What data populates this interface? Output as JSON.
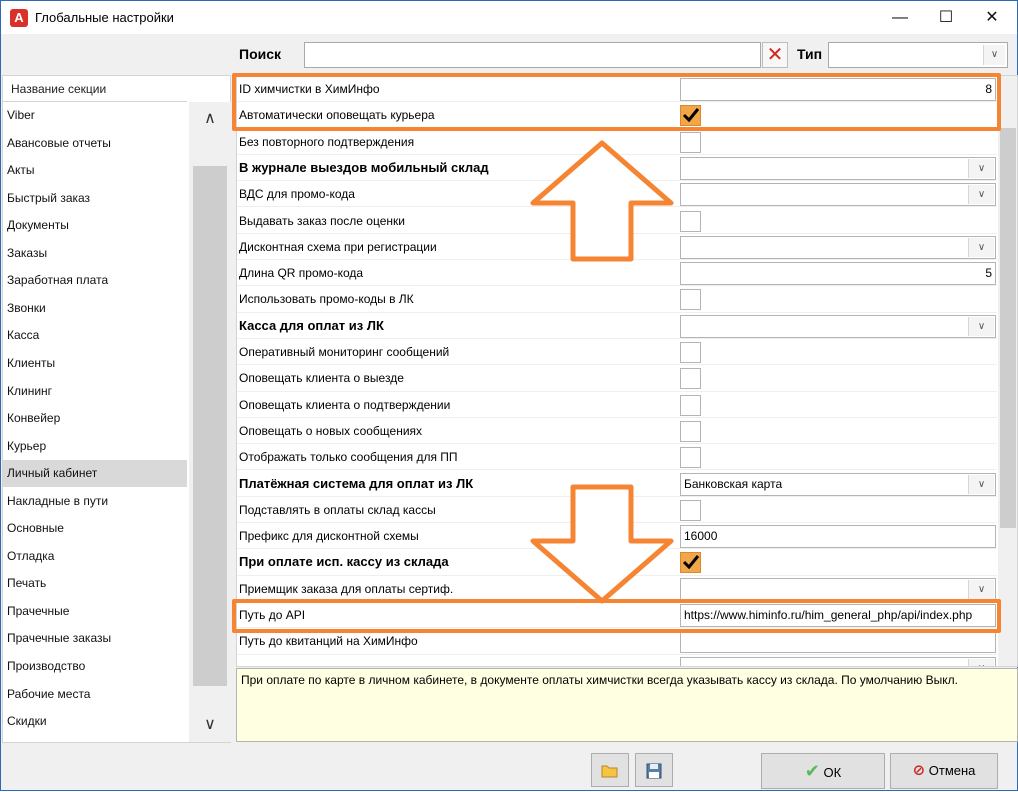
{
  "window": {
    "title": "Глобальные настройки",
    "app_icon_letter": "A",
    "minimize_glyph": "—",
    "maximize_glyph": "☐",
    "close_glyph": "✕"
  },
  "search": {
    "label": "Поиск",
    "value": "",
    "clear_glyph": "✕",
    "type_label": "Тип",
    "type_value": ""
  },
  "sidebar": {
    "header": "Название секции",
    "items": [
      {
        "label": "Viber"
      },
      {
        "label": "Авансовые отчеты"
      },
      {
        "label": "Акты"
      },
      {
        "label": "Быстрый заказ"
      },
      {
        "label": "Документы"
      },
      {
        "label": "Заказы"
      },
      {
        "label": "Заработная плата"
      },
      {
        "label": "Звонки"
      },
      {
        "label": "Касса"
      },
      {
        "label": "Клиенты"
      },
      {
        "label": "Клининг"
      },
      {
        "label": "Конвейер"
      },
      {
        "label": "Курьер"
      },
      {
        "label": "Личный кабинет",
        "selected": true
      },
      {
        "label": "Накладные в пути"
      },
      {
        "label": "Основные"
      },
      {
        "label": "Отладка"
      },
      {
        "label": "Печать"
      },
      {
        "label": "Прачечные"
      },
      {
        "label": "Прачечные заказы"
      },
      {
        "label": "Производство"
      },
      {
        "label": "Рабочие места"
      },
      {
        "label": "Скидки"
      }
    ]
  },
  "properties": [
    {
      "label": "ID химчистки в ХимИнфо",
      "bold": false,
      "kind": "input",
      "value": "8",
      "align": "right"
    },
    {
      "label": "Автоматически оповещать курьера",
      "bold": false,
      "kind": "checkbox",
      "checked": true
    },
    {
      "label": "Без повторного подтверждения",
      "bold": false,
      "kind": "checkbox",
      "checked": false
    },
    {
      "label": "В журнале выездов мобильный склад",
      "bold": true,
      "kind": "select",
      "value": ""
    },
    {
      "label": "ВДС для промо-кода",
      "bold": false,
      "kind": "select",
      "value": ""
    },
    {
      "label": "Выдавать заказ после оценки",
      "bold": false,
      "kind": "checkbox",
      "checked": false
    },
    {
      "label": "Дисконтная схема при регистрации",
      "bold": false,
      "kind": "select",
      "value": ""
    },
    {
      "label": "Длина QR промо-кода",
      "bold": false,
      "kind": "input",
      "value": "5",
      "align": "right"
    },
    {
      "label": "Использовать промо-коды в ЛК",
      "bold": false,
      "kind": "checkbox",
      "checked": false
    },
    {
      "label": "Касса для оплат из ЛК",
      "bold": true,
      "kind": "select",
      "value": ""
    },
    {
      "label": "Оперативный мониторинг сообщений",
      "bold": false,
      "kind": "checkbox",
      "checked": false
    },
    {
      "label": "Оповещать клиента о выезде",
      "bold": false,
      "kind": "checkbox",
      "checked": false
    },
    {
      "label": "Оповещать клиента о подтверждении",
      "bold": false,
      "kind": "checkbox",
      "checked": false
    },
    {
      "label": "Оповещать о новых сообщениях",
      "bold": false,
      "kind": "checkbox",
      "checked": false
    },
    {
      "label": "Отображать только сообщения для ПП",
      "bold": false,
      "kind": "checkbox",
      "checked": false
    },
    {
      "label": "Платёжная система для оплат из ЛК",
      "bold": true,
      "kind": "select",
      "value": "Банковская карта"
    },
    {
      "label": "Подставлять в оплаты склад кассы",
      "bold": false,
      "kind": "checkbox",
      "checked": false
    },
    {
      "label": "Префикс для дисконтной схемы",
      "bold": false,
      "kind": "input",
      "value": "16000",
      "align": "left"
    },
    {
      "label": "При оплате исп. кассу из склада",
      "bold": true,
      "kind": "checkbox",
      "checked": true
    },
    {
      "label": "Приемщик заказа для оплаты сертиф.",
      "bold": false,
      "kind": "select",
      "value": ""
    },
    {
      "label": "Путь до API",
      "bold": false,
      "kind": "input",
      "value": "https://www.himinfo.ru/him_general_php/api/index.php",
      "align": "left"
    },
    {
      "label": "Путь до квитанций на ХимИнфо",
      "bold": false,
      "kind": "input",
      "value": "",
      "align": "left"
    },
    {
      "label": "",
      "bold": false,
      "kind": "select",
      "value": ""
    }
  ],
  "description": "При оплате по карте в личном кабинете, в документе оплаты химчистки всегда указывать кассу из склада. По умолчанию Выкл.",
  "buttons": {
    "ok_label": "ОК",
    "cancel_label": "Отмена"
  },
  "colors": {
    "annotation": "#f58433",
    "checkbox_checked": "#f3a54a",
    "description_bg": "#ffffe1",
    "ok_check": "#5cb85c",
    "cancel_icon": "#d0281f"
  },
  "icons": {
    "folder": "folder-icon",
    "save": "save-icon",
    "ok": "check-icon",
    "cancel": "no-entry-icon",
    "arrow_up": "arrow-up-annotation",
    "arrow_down": "arrow-down-annotation"
  }
}
